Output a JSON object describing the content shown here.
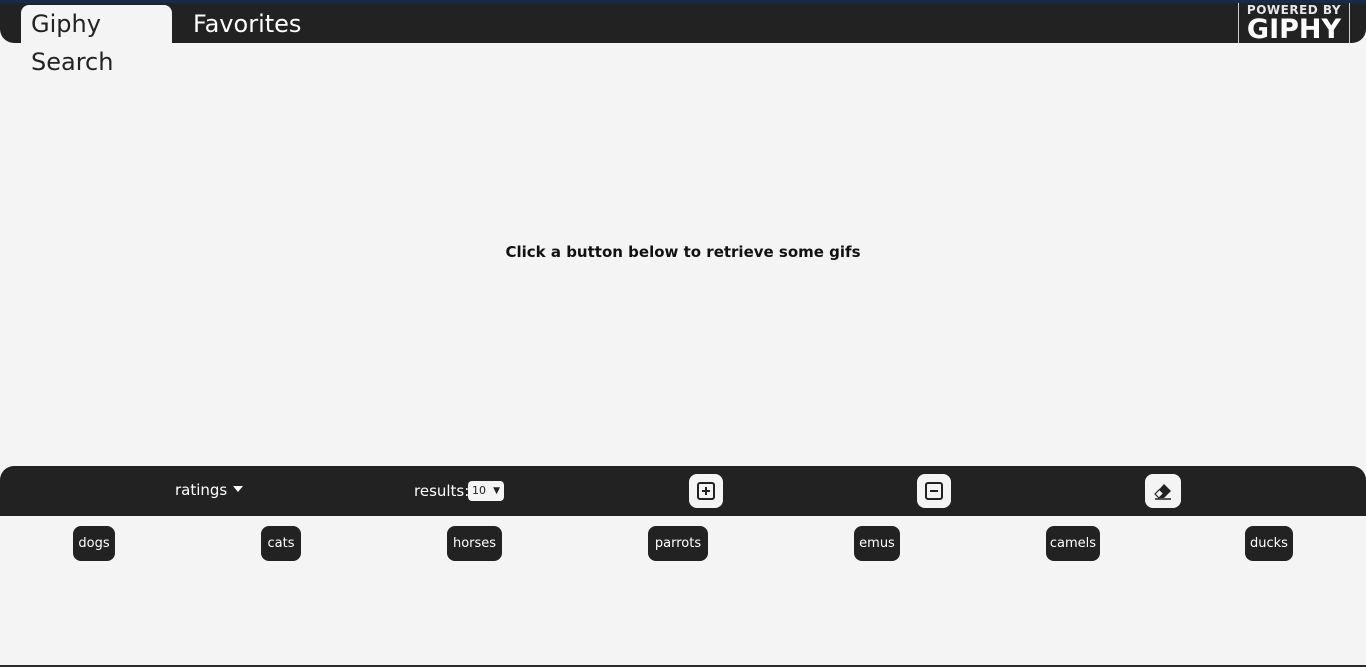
{
  "tabs": {
    "search_label": "Giphy Search",
    "favorites_label": "Favorites"
  },
  "logo": {
    "powered_by": "POWERED BY",
    "brand": "GIPHY"
  },
  "main": {
    "empty_message": "Click a button below to retrieve some gifs"
  },
  "controls": {
    "ratings_label": "ratings",
    "results_label": "results:",
    "results_value": "10",
    "add_icon": "plus-square-icon",
    "remove_icon": "minus-square-icon",
    "clear_icon": "eraser-icon"
  },
  "topics": [
    "dogs",
    "cats",
    "horses",
    "parrots",
    "emus",
    "camels",
    "ducks"
  ],
  "colors": {
    "bar": "#222222",
    "background": "#f4f4f4",
    "accent": "#1b2a44"
  }
}
